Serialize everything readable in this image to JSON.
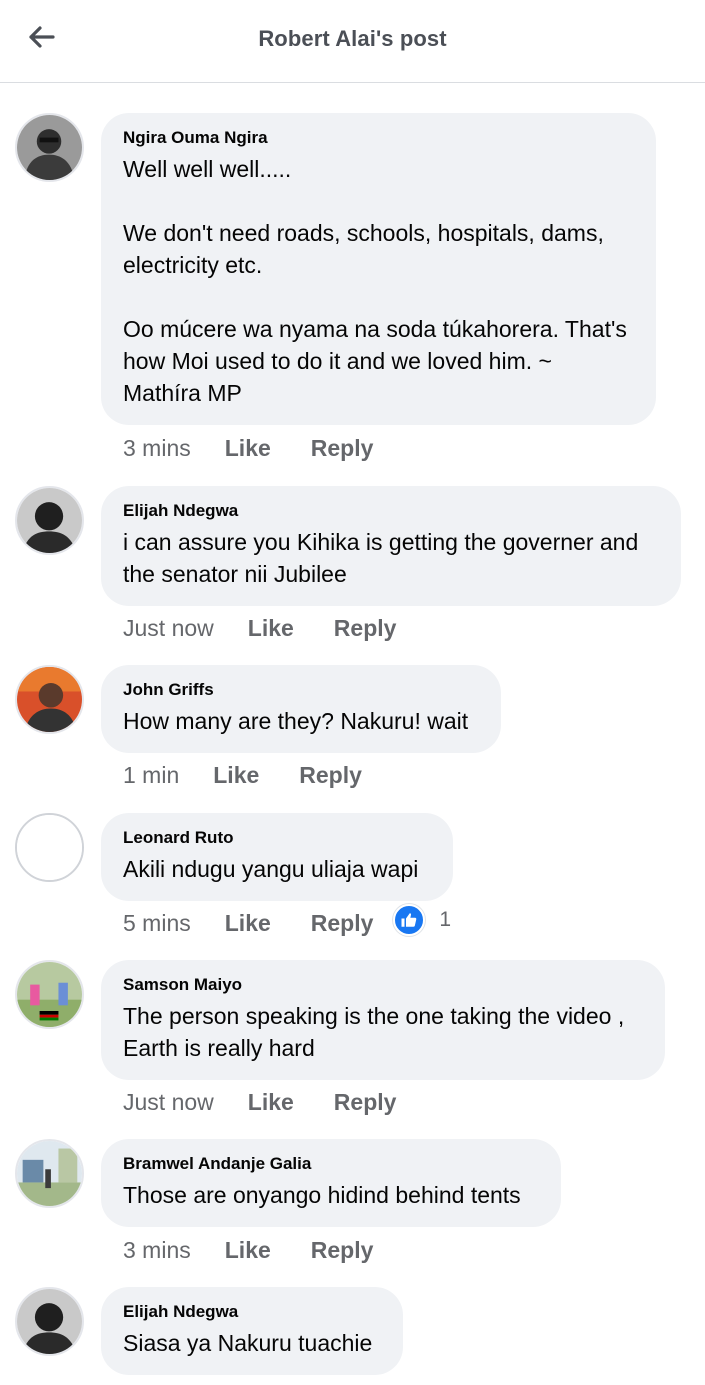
{
  "header": {
    "title": "Robert Alai's post"
  },
  "comments": [
    {
      "author": "Ngira Ouma Ngira",
      "text": "Well well well.....\n\nWe don't need roads, schools, hospitals, dams, electricity etc.\n\nOo múcere wa nyama na soda túkahorera. That's how Moi used to do it and we loved him. ~ Mathíra MP",
      "time": "3 mins",
      "like_label": "Like",
      "reply_label": "Reply"
    },
    {
      "author": "Elijah Ndegwa",
      "text": "i can assure you Kihika is getting the governer and the senator nii Jubilee",
      "time": "Just now",
      "like_label": "Like",
      "reply_label": "Reply"
    },
    {
      "author": "John Griffs",
      "text": "How many are they? Nakuru! wait",
      "time": "1 min",
      "like_label": "Like",
      "reply_label": "Reply"
    },
    {
      "author": "Leonard Ruto",
      "text": "Akili ndugu yangu uliaja wapi",
      "time": "5 mins",
      "like_label": "Like",
      "reply_label": "Reply",
      "reaction_count": "1"
    },
    {
      "author": "Samson Maiyo",
      "text": "The person speaking is the one taking the video , Earth is really hard",
      "time": "Just now",
      "like_label": "Like",
      "reply_label": "Reply"
    },
    {
      "author": "Bramwel Andanje Galia",
      "text": "Those are onyango hidind behind tents",
      "time": "3 mins",
      "like_label": "Like",
      "reply_label": "Reply"
    },
    {
      "author": "Elijah Ndegwa",
      "text": "Siasa ya Nakuru tuachie",
      "time": null,
      "like_label": null,
      "reply_label": null
    }
  ],
  "colors": {
    "bubble": "#f0f2f5",
    "meta": "#65676b",
    "like_blue": "#1877f2",
    "divider": "#dadde1"
  },
  "icons": {
    "back": "arrow-left-icon",
    "reaction": "thumbs-up-icon"
  }
}
